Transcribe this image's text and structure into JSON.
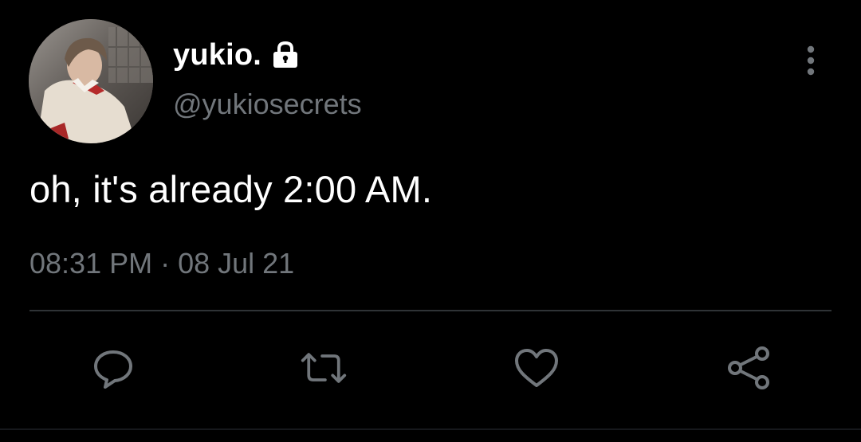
{
  "author": {
    "display_name": "yukio.",
    "handle": "@yukiosecrets",
    "protected_icon": "lock-icon",
    "avatar": "profile-photo"
  },
  "tweet": {
    "text": "oh, it's already 2:00 AM.",
    "timestamp": "08:31 PM · 08 Jul 21"
  },
  "actions": [
    {
      "name": "reply",
      "icon": "reply-icon"
    },
    {
      "name": "retweet",
      "icon": "retweet-icon"
    },
    {
      "name": "like",
      "icon": "heart-icon"
    },
    {
      "name": "share",
      "icon": "share-icon"
    }
  ],
  "menu_icon": "more-vertical-icon",
  "colors": {
    "background": "#000000",
    "primary_text": "#ffffff",
    "secondary_text": "#71767b",
    "divider": "#2f3336"
  }
}
